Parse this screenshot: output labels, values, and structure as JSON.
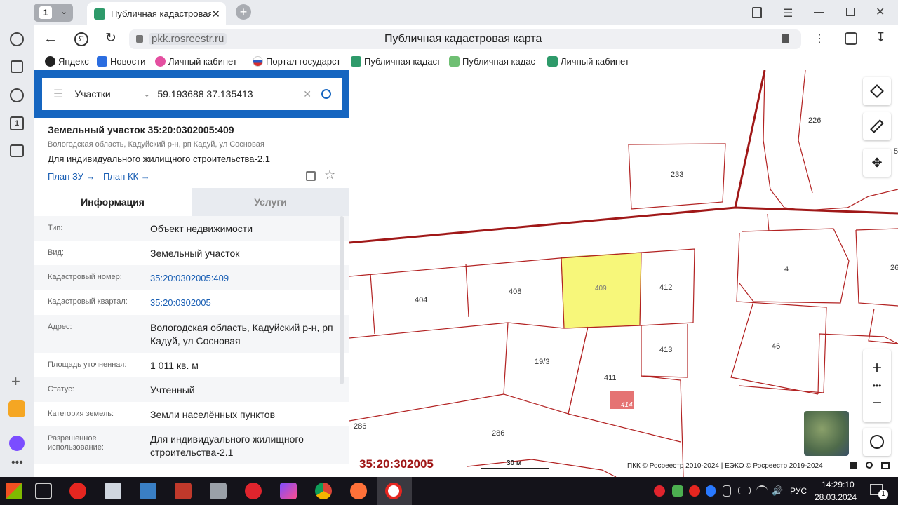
{
  "browser": {
    "tab_count": "1",
    "tab_title": "Публичная кадастровая",
    "url": "pkk.rosreestr.ru",
    "page_title": "Публичная кадастровая карта",
    "bookmarks": [
      "Яндекс",
      "Новости",
      "Личный кабинет",
      "Портал государст",
      "Публичная кадаст",
      "Публичная кадаст",
      "Личный кабинет"
    ]
  },
  "search": {
    "mode": "Участки",
    "value": "59.193688 37.135413"
  },
  "parcel": {
    "title": "Земельный участок 35:20:0302005:409",
    "address_line": "Вологодская область, Кадуйский р-н, рп Кадуй, ул Сосновая",
    "purpose": "Для индивидуального жилищного строительства-2.1",
    "plan_zu": "План ЗУ",
    "plan_kk": "План КК"
  },
  "tabs": {
    "info": "Информация",
    "services": "Услуги"
  },
  "rows": [
    {
      "label": "Тип:",
      "value": "Объект недвижимости"
    },
    {
      "label": "Вид:",
      "value": "Земельный участок"
    },
    {
      "label": "Кадастровый номер:",
      "value": "35:20:0302005:409"
    },
    {
      "label": "Кадастровый квартал:",
      "value": "35:20:0302005"
    },
    {
      "label": "Адрес:",
      "value": "Вологодская область, Кадуйский р-н, рп Кадуй, ул Сосновая"
    },
    {
      "label": "Площадь уточненная:",
      "value": "1 011 кв. м"
    },
    {
      "label": "Статус:",
      "value": "Учтенный"
    },
    {
      "label": "Категория земель:",
      "value": "Земли населённых пунктов"
    },
    {
      "label": "Разрешенное использование:",
      "value": "Для индивидуального жилищного строительства-2.1"
    }
  ],
  "map": {
    "parcel_labels": [
      "226",
      "233",
      "404",
      "408",
      "409",
      "412",
      "4",
      "46",
      "19/3",
      "413",
      "411",
      "414",
      "286",
      "286",
      "26",
      "5"
    ],
    "quarter_label": "35:20:302005",
    "scale_label": "30 м",
    "copyright": "ПКК © Росреестр 2010-2024 | ЕЭКО © Росреестр 2019-2024",
    "colors": {
      "boundary": "#b22222",
      "selected_fill": "#f7f77a",
      "small_parcel": "#e57373"
    }
  },
  "taskbar": {
    "language": "РУС",
    "time": "14:29:10",
    "date": "28.03.2024",
    "notifications": "1"
  }
}
